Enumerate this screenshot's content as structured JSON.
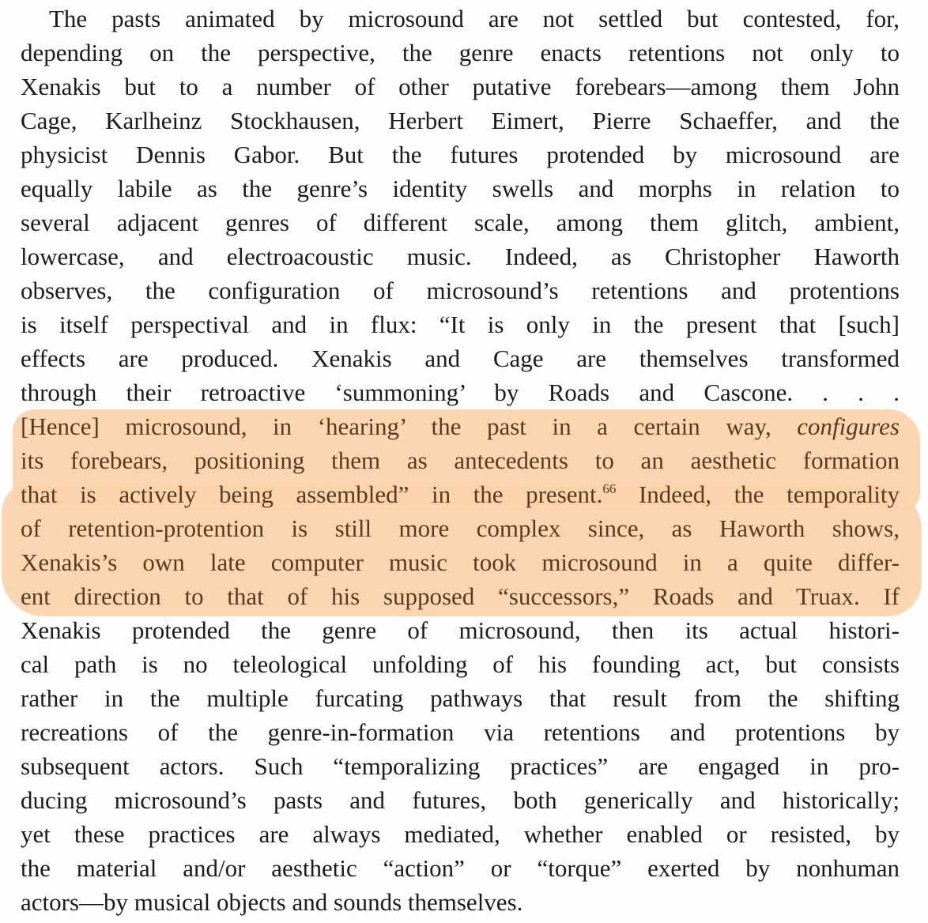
{
  "paragraph": {
    "lines": [
      "The pasts animated by microsound are not settled but contested, for,",
      "depending on the perspective, the genre enacts retentions not only to",
      "Xenakis but to a number of other putative forebears—among them John",
      "Cage, Karlheinz Stockhausen, Herbert Eimert, Pierre Schaeffer, and the",
      "physicist Dennis Gabor. But the futures protended by microsound are",
      "equally labile as the genre’s identity swells and morphs in relation to",
      "several adjacent genres of different scale, among them glitch, ambient,",
      "lowercase, and electroacoustic music. Indeed, as Christopher Haworth",
      "observes, the configuration of microsound’s retentions and protentions",
      "is itself perspectival and in flux: “It is only in the present that [such]",
      "effects are produced. Xenakis and Cage are themselves transformed",
      "through their retroactive ‘summoning’ by Roads and Cascone. . . .",
      {
        "before": "[Hence] microsound, in ‘hearing’ the past in a certain way, ",
        "italic": "configures"
      },
      "its forebears, positioning them as antecedents to an aesthetic formation",
      {
        "before": "that is actively being assembled” in the present.",
        "note": "66",
        "after": " Indeed, the temporality"
      },
      "of retention-protention is still more complex since, as Haworth shows,",
      "Xenakis’s own late computer music took microsound in a quite differ-",
      "ent direction to that of his supposed “successors,” Roads and Truax. If",
      "Xenakis protended the genre of microsound, then its actual histori-",
      "cal path is no teleological unfolding of his founding act, but consists",
      "rather in the multiple furcating pathways that result from the shifting",
      "recreations of the genre-in-formation via retentions and protentions by",
      "subsequent actors. Such “temporalizing practices” are engaged in pro-",
      "ducing microsound’s pasts and futures, both generically and historically;",
      "yet these practices are always mediated, whether enabled or resisted, by",
      "the material and/or aesthetic “action” or “torque” exerted by nonhuman",
      "actors—by musical objects and sounds themselves."
    ]
  },
  "colors": {
    "text": "#1b1b1b",
    "highlight": "#fbd3ac",
    "highlighted_text": "#5a3a1c"
  }
}
